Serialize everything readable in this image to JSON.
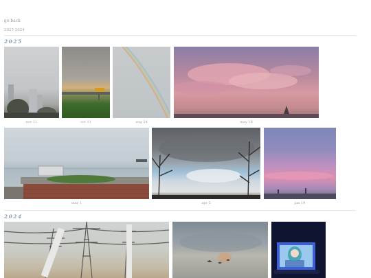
{
  "nav": {
    "back_label": "go back"
  },
  "years_nav": {
    "label": "2025 2024"
  },
  "sections": [
    {
      "year": "2025",
      "photos": [
        {
          "caption": "nov 11",
          "description": "foggy city with tall building and trees"
        },
        {
          "caption": "oct 11",
          "description": "sunset over grass field with sign"
        },
        {
          "caption": "aug 24",
          "description": "rainbow on grey sky"
        },
        {
          "caption": "may 18",
          "description": "pink and purple clouds at dusk"
        },
        {
          "caption": "may 1",
          "description": "sea view with red brick rooftop garden"
        },
        {
          "caption": "apr 5",
          "description": "storm clouds and bare trees"
        },
        {
          "caption": "jan 19",
          "description": "pink sunset horizon"
        }
      ]
    },
    {
      "year": "2024",
      "photos": [
        {
          "caption": "",
          "description": "foggy power lines pylons"
        },
        {
          "caption": "",
          "description": "cloudy sky with faint rainbow"
        },
        {
          "caption": "",
          "description": "anime screen in dark room"
        }
      ]
    }
  ],
  "colors": {
    "heading": "#8fa0b5",
    "rule": "#e8e8e8",
    "text": "#9a9a9a"
  }
}
